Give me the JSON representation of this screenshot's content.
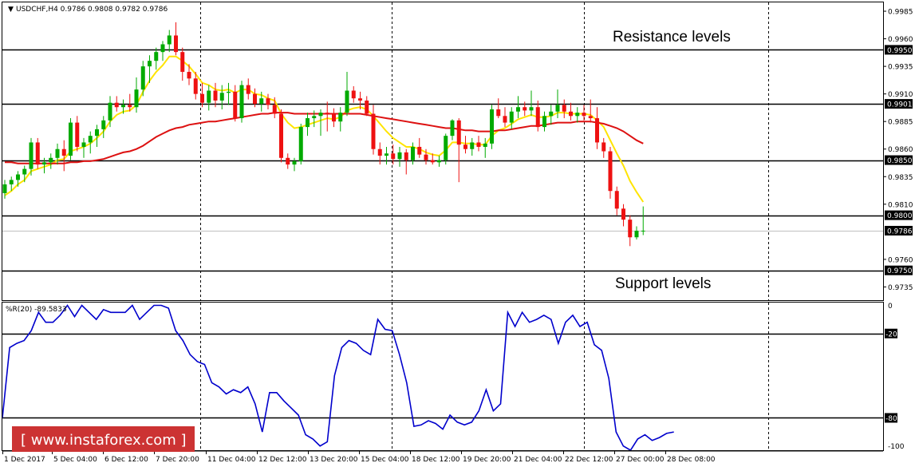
{
  "chart_data": [
    {
      "type": "candlestick",
      "header": "USDCHF,H4  0.9786 0.9808 0.9782 0.9786",
      "annotations": {
        "resistance": "Resistance levels",
        "support": "Support levels"
      },
      "ylim": [
        0.9723,
        0.9993
      ],
      "yticks": [
        "0.9985",
        "0.9960",
        "0.9935",
        "0.9910",
        "0.9885",
        "0.9860",
        "0.9835",
        "0.9810",
        "0.9760",
        "0.9735"
      ],
      "levels": [
        "0.9950",
        "0.9901",
        "0.9850",
        "0.9800",
        "0.9750"
      ],
      "current_price": "0.9786",
      "xtick_labels": [
        "1 Dec 2017",
        "5 Dec 04:00",
        "6 Dec 12:00",
        "7 Dec 20:00",
        "11 Dec 04:00",
        "12 Dec 12:00",
        "13 Dec 20:00",
        "15 Dec 04:00",
        "18 Dec 12:00",
        "19 Dec 20:00",
        "21 Dec 04:00",
        "22 Dec 12:00",
        "27 Dec 00:00",
        "28 Dec 08:00"
      ],
      "candles": [
        [
          0.982,
          0.9832,
          0.9815,
          0.9828
        ],
        [
          0.9828,
          0.9835,
          0.9822,
          0.9832
        ],
        [
          0.9832,
          0.984,
          0.9826,
          0.9837
        ],
        [
          0.9837,
          0.9845,
          0.983,
          0.9842
        ],
        [
          0.9842,
          0.987,
          0.9836,
          0.9866
        ],
        [
          0.9866,
          0.987,
          0.9842,
          0.9846
        ],
        [
          0.9846,
          0.9852,
          0.9838,
          0.9848
        ],
        [
          0.9848,
          0.9856,
          0.9842,
          0.9852
        ],
        [
          0.9852,
          0.9865,
          0.9846,
          0.986
        ],
        [
          0.986,
          0.9868,
          0.984,
          0.9854
        ],
        [
          0.9854,
          0.9888,
          0.985,
          0.9884
        ],
        [
          0.9884,
          0.989,
          0.9858,
          0.9862
        ],
        [
          0.9862,
          0.987,
          0.9852,
          0.9866
        ],
        [
          0.9866,
          0.9876,
          0.9856,
          0.9872
        ],
        [
          0.9872,
          0.9882,
          0.9862,
          0.9878
        ],
        [
          0.9878,
          0.989,
          0.987,
          0.9886
        ],
        [
          0.9886,
          0.9908,
          0.988,
          0.9902
        ],
        [
          0.9902,
          0.9908,
          0.9894,
          0.9898
        ],
        [
          0.9898,
          0.9905,
          0.9892,
          0.99
        ],
        [
          0.99,
          0.991,
          0.9894,
          0.9898
        ],
        [
          0.9898,
          0.9925,
          0.9893,
          0.9914
        ],
        [
          0.9914,
          0.994,
          0.9908,
          0.9935
        ],
        [
          0.9935,
          0.9945,
          0.992,
          0.994
        ],
        [
          0.994,
          0.9952,
          0.9932,
          0.9948
        ],
        [
          0.9948,
          0.9958,
          0.994,
          0.9955
        ],
        [
          0.9955,
          0.9968,
          0.9948,
          0.9963
        ],
        [
          0.9963,
          0.9975,
          0.9945,
          0.9948
        ],
        [
          0.9948,
          0.9952,
          0.9922,
          0.993
        ],
        [
          0.993,
          0.9937,
          0.9918,
          0.9924
        ],
        [
          0.9924,
          0.993,
          0.9905,
          0.991
        ],
        [
          0.991,
          0.992,
          0.9898,
          0.9902
        ],
        [
          0.9902,
          0.9918,
          0.9895,
          0.9913
        ],
        [
          0.9913,
          0.992,
          0.9898,
          0.9904
        ],
        [
          0.9904,
          0.9918,
          0.9896,
          0.9911
        ],
        [
          0.9911,
          0.992,
          0.99,
          0.9912
        ],
        [
          0.9912,
          0.9918,
          0.9885,
          0.9888
        ],
        [
          0.9888,
          0.9922,
          0.9884,
          0.9918
        ],
        [
          0.9918,
          0.9924,
          0.9905,
          0.991
        ],
        [
          0.991,
          0.9915,
          0.9898,
          0.9901
        ],
        [
          0.9901,
          0.9912,
          0.9894,
          0.9906
        ],
        [
          0.9906,
          0.991,
          0.9896,
          0.99
        ],
        [
          0.99,
          0.9907,
          0.9888,
          0.9892
        ],
        [
          0.9892,
          0.9896,
          0.9848,
          0.9852
        ],
        [
          0.9852,
          0.9856,
          0.9842,
          0.9846
        ],
        [
          0.9846,
          0.9852,
          0.984,
          0.9849
        ],
        [
          0.9849,
          0.9883,
          0.9846,
          0.988
        ],
        [
          0.988,
          0.9893,
          0.9872,
          0.9888
        ],
        [
          0.9888,
          0.9895,
          0.988,
          0.989
        ],
        [
          0.989,
          0.9896,
          0.9872,
          0.9893
        ],
        [
          0.9893,
          0.9903,
          0.9876,
          0.9892
        ],
        [
          0.9892,
          0.9897,
          0.988,
          0.9885
        ],
        [
          0.9885,
          0.9898,
          0.9876,
          0.9893
        ],
        [
          0.9893,
          0.993,
          0.989,
          0.9913
        ],
        [
          0.9913,
          0.9917,
          0.9902,
          0.9906
        ],
        [
          0.9906,
          0.9912,
          0.9896,
          0.9904
        ],
        [
          0.9904,
          0.9908,
          0.989,
          0.9892
        ],
        [
          0.9892,
          0.99,
          0.9855,
          0.986
        ],
        [
          0.986,
          0.9866,
          0.9846,
          0.9854
        ],
        [
          0.9854,
          0.9862,
          0.9846,
          0.9856
        ],
        [
          0.9856,
          0.9864,
          0.9846,
          0.9851
        ],
        [
          0.9851,
          0.9862,
          0.9844,
          0.9857
        ],
        [
          0.9857,
          0.986,
          0.9837,
          0.985
        ],
        [
          0.985,
          0.9866,
          0.9846,
          0.9862
        ],
        [
          0.9862,
          0.987,
          0.9852,
          0.9855
        ],
        [
          0.9855,
          0.986,
          0.9846,
          0.985
        ],
        [
          0.985,
          0.9856,
          0.9846,
          0.9848
        ],
        [
          0.9848,
          0.9854,
          0.9844,
          0.985
        ],
        [
          0.985,
          0.9874,
          0.9846,
          0.9872
        ],
        [
          0.9872,
          0.9887,
          0.9868,
          0.9886
        ],
        [
          0.9886,
          0.9888,
          0.983,
          0.9864
        ],
        [
          0.9864,
          0.9872,
          0.9856,
          0.986
        ],
        [
          0.986,
          0.987,
          0.9854,
          0.9866
        ],
        [
          0.9866,
          0.9872,
          0.9858,
          0.9862
        ],
        [
          0.9862,
          0.987,
          0.9852,
          0.9865
        ],
        [
          0.9865,
          0.99,
          0.986,
          0.9896
        ],
        [
          0.9896,
          0.9906,
          0.9888,
          0.989
        ],
        [
          0.989,
          0.9898,
          0.988,
          0.9884
        ],
        [
          0.9884,
          0.9898,
          0.9878,
          0.9894
        ],
        [
          0.9894,
          0.9908,
          0.9888,
          0.9898
        ],
        [
          0.9898,
          0.9903,
          0.989,
          0.9895
        ],
        [
          0.9895,
          0.9913,
          0.989,
          0.9898
        ],
        [
          0.9898,
          0.9904,
          0.9876,
          0.988
        ],
        [
          0.988,
          0.9894,
          0.9876,
          0.989
        ],
        [
          0.989,
          0.99,
          0.9882,
          0.9894
        ],
        [
          0.9894,
          0.9914,
          0.9888,
          0.99
        ],
        [
          0.99,
          0.9905,
          0.9888,
          0.9894
        ],
        [
          0.9894,
          0.9902,
          0.9886,
          0.989
        ],
        [
          0.989,
          0.9898,
          0.9884,
          0.9893
        ],
        [
          0.9893,
          0.99,
          0.9886,
          0.989
        ],
        [
          0.989,
          0.9905,
          0.9884,
          0.9888
        ],
        [
          0.9888,
          0.9898,
          0.986,
          0.9866
        ],
        [
          0.9866,
          0.987,
          0.9852,
          0.9858
        ],
        [
          0.9858,
          0.9862,
          0.9815,
          0.9822
        ],
        [
          0.9822,
          0.9826,
          0.98,
          0.9806
        ],
        [
          0.9806,
          0.981,
          0.979,
          0.9796
        ],
        [
          0.9796,
          0.98,
          0.9772,
          0.978
        ],
        [
          0.978,
          0.979,
          0.9778,
          0.9786
        ],
        [
          0.9786,
          0.9808,
          0.9782,
          0.9786
        ]
      ],
      "series": [
        {
          "type": "line",
          "color": "#ffe400",
          "values": [
            0.9818,
            0.9822,
            0.9828,
            0.9832,
            0.984,
            0.9842,
            0.9844,
            0.9846,
            0.985,
            0.9851,
            0.9858,
            0.986,
            0.9862,
            0.9865,
            0.987,
            0.9876,
            0.9885,
            0.9891,
            0.9894,
            0.9895,
            0.99,
            0.9912,
            0.9922,
            0.993,
            0.9936,
            0.9944,
            0.9944,
            0.994,
            0.9935,
            0.9928,
            0.992,
            0.9918,
            0.9914,
            0.9913,
            0.9914,
            0.9911,
            0.9914,
            0.9914,
            0.991,
            0.9909,
            0.9906,
            0.9904,
            0.9892,
            0.9884,
            0.9879,
            0.988,
            0.9882,
            0.9884,
            0.9886,
            0.9888,
            0.9887,
            0.9889,
            0.9895,
            0.9897,
            0.9898,
            0.9896,
            0.989,
            0.9883,
            0.9876,
            0.987,
            0.9866,
            0.9862,
            0.9862,
            0.986,
            0.9857,
            0.9855,
            0.9854,
            0.9859,
            0.9866,
            0.9866,
            0.9865,
            0.9865,
            0.9864,
            0.9864,
            0.9872,
            0.9877,
            0.9879,
            0.9883,
            0.9887,
            0.9889,
            0.9891,
            0.9889,
            0.9889,
            0.989,
            0.9893,
            0.9893,
            0.9892,
            0.9892,
            0.9892,
            0.9891,
            0.9886,
            0.988,
            0.9868,
            0.9856,
            0.9845,
            0.9831,
            0.9821,
            0.9812
          ]
        },
        {
          "type": "line",
          "color": "#dd1111",
          "values": [
            0.9848,
            0.9848,
            0.9847,
            0.9847,
            0.9847,
            0.9847,
            0.9847,
            0.9847,
            0.9847,
            0.9847,
            0.9848,
            0.9848,
            0.9849,
            0.9849,
            0.985,
            0.9851,
            0.9853,
            0.9855,
            0.9857,
            0.9858,
            0.986,
            0.9863,
            0.9867,
            0.9871,
            0.9874,
            0.9877,
            0.9879,
            0.988,
            0.9882,
            0.9883,
            0.9884,
            0.9885,
            0.9885,
            0.9886,
            0.9887,
            0.9888,
            0.9889,
            0.989,
            0.9891,
            0.9892,
            0.9892,
            0.9893,
            0.9893,
            0.9893,
            0.9892,
            0.9892,
            0.9892,
            0.9892,
            0.9892,
            0.9892,
            0.9892,
            0.9892,
            0.9892,
            0.9892,
            0.9892,
            0.9891,
            0.989,
            0.9889,
            0.9888,
            0.9887,
            0.9886,
            0.9885,
            0.9884,
            0.9883,
            0.9882,
            0.9881,
            0.988,
            0.9879,
            0.9879,
            0.9878,
            0.9877,
            0.9877,
            0.9876,
            0.9876,
            0.9876,
            0.9877,
            0.9877,
            0.9878,
            0.9879,
            0.988,
            0.9881,
            0.9881,
            0.9882,
            0.9883,
            0.9884,
            0.9884,
            0.9884,
            0.9885,
            0.9885,
            0.9885,
            0.9884,
            0.9883,
            0.9881,
            0.9879,
            0.9876,
            0.9872,
            0.9868,
            0.9865
          ]
        }
      ]
    },
    {
      "type": "line",
      "title": "%R(20) -89.5833",
      "ylim": [
        -103,
        2
      ],
      "yticks": [
        "0",
        "-20",
        "-80",
        "-100"
      ],
      "levels": [
        -20,
        -80
      ],
      "series": [
        {
          "name": "%R(20)",
          "color": "#0000cc",
          "values": [
            -80,
            -30,
            -27,
            -25,
            -18,
            -5,
            -12,
            -12,
            -7,
            0,
            -8,
            0,
            -5,
            -10,
            -3,
            -5,
            -5,
            -5,
            0,
            -10,
            -5,
            0,
            0,
            -2,
            -18,
            -25,
            -35,
            -40,
            -42,
            -55,
            -58,
            -63,
            -60,
            -62,
            -58,
            -70,
            -90,
            -62,
            -62,
            -68,
            -73,
            -78,
            -92,
            -95,
            -100,
            -97,
            -50,
            -30,
            -25,
            -27,
            -32,
            -35,
            -10,
            -17,
            -18,
            -35,
            -55,
            -86,
            -85,
            -82,
            -84,
            -88,
            -78,
            -83,
            -85,
            -83,
            -75,
            -60,
            -75,
            -70,
            -5,
            -15,
            -5,
            -12,
            -10,
            -7,
            -10,
            -27,
            -12,
            -7,
            -15,
            -12,
            -28,
            -32,
            -52,
            -90,
            -100,
            -103,
            -95,
            -92,
            -96,
            -94,
            -91,
            -90
          ]
        }
      ]
    }
  ],
  "watermark": "[ www.instaforex.com ]",
  "colors": {
    "bull": "#00aa00",
    "bear": "#ee1111",
    "grid": "#000000",
    "axis": "#000000"
  }
}
